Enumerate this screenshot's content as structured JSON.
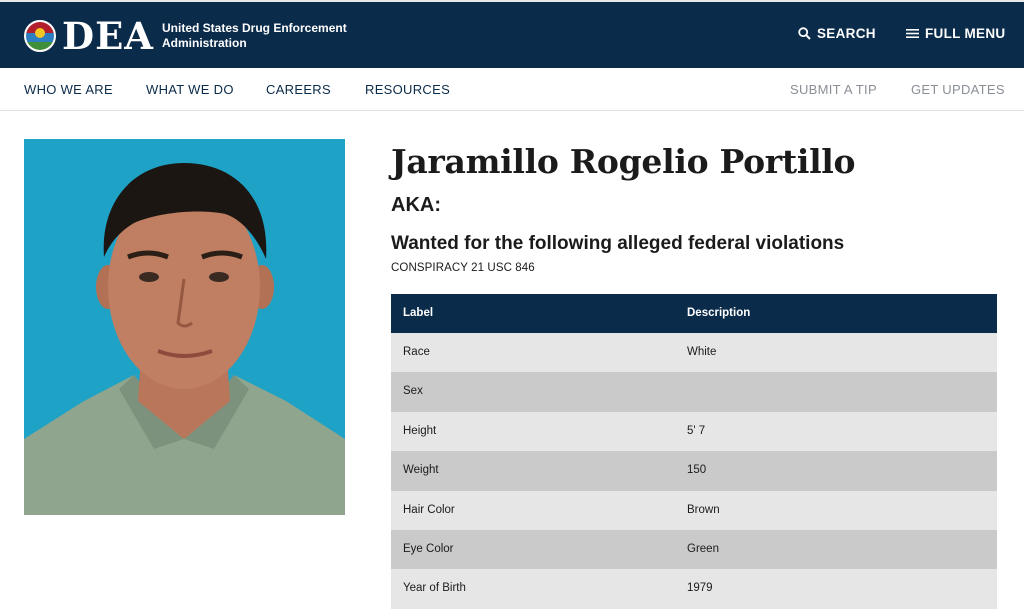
{
  "header": {
    "logo_text": "DEA",
    "logo_tagline": "United States Drug Enforcement Administration",
    "search_label": "SEARCH",
    "menu_label": "FULL MENU",
    "icons": [
      "dea-seal-icon",
      "search-icon",
      "hamburger-menu-icon"
    ]
  },
  "nav": {
    "items": [
      "WHO WE ARE",
      "WHAT WE DO",
      "CAREERS",
      "RESOURCES"
    ],
    "right_items": [
      "SUBMIT A TIP",
      "GET UPDATES"
    ]
  },
  "profile": {
    "name": "Jaramillo Rogelio Portillo",
    "aka_label": "AKA:",
    "wanted_heading": "Wanted for the following alleged federal violations",
    "violation": "CONSPIRACY 21 USC 846"
  },
  "table": {
    "headers": [
      "Label",
      "Description"
    ],
    "rows": [
      {
        "label": "Race",
        "value": "White"
      },
      {
        "label": "Sex",
        "value": ""
      },
      {
        "label": "Height",
        "value": "5' 7"
      },
      {
        "label": "Weight",
        "value": "150"
      },
      {
        "label": "Hair Color",
        "value": "Brown"
      },
      {
        "label": "Eye Color",
        "value": "Green"
      },
      {
        "label": "Year of Birth",
        "value": "1979"
      }
    ]
  },
  "colors": {
    "brand_navy": "#0b2b4a",
    "photo_background": "#1ea2c6",
    "row_light": "#e6e6e6",
    "row_dark": "#cacaca"
  }
}
